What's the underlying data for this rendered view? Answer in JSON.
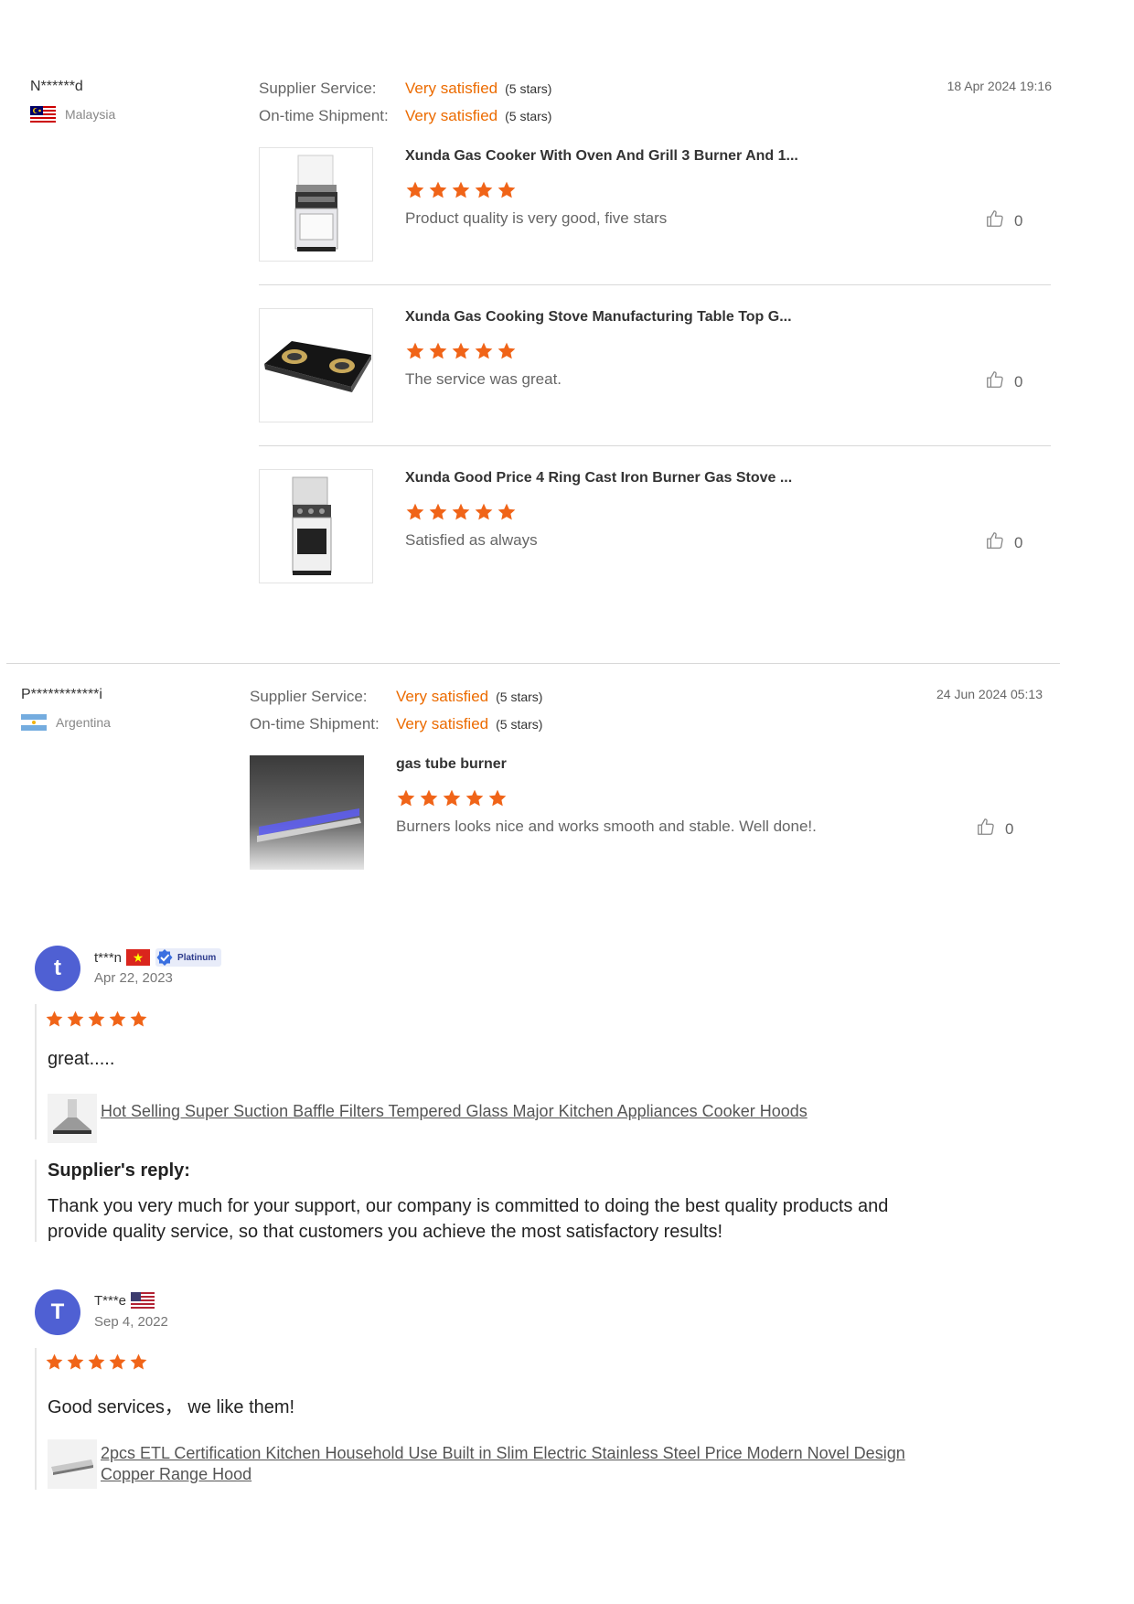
{
  "colors": {
    "accent": "#ec6b00",
    "star": "#f06418",
    "avatar": "#4f60d3"
  },
  "reviews": [
    {
      "user": "N******d",
      "country": "Malaysia",
      "flag": "malaysia-flag",
      "supplier_service_label": "Supplier Service:",
      "supplier_service_value": "Very satisfied",
      "supplier_service_stars": "(5 stars)",
      "shipment_label": "On-time Shipment:",
      "shipment_value": "Very satisfied",
      "shipment_stars": "(5 stars)",
      "date": "18 Apr 2024 19:16",
      "items": [
        {
          "title": "Xunda Gas Cooker With Oven And Grill 3 Burner And 1...",
          "rating": 5,
          "text": "Product quality is very good, five stars",
          "likes": "0"
        },
        {
          "title": "Xunda Gas Cooking Stove Manufacturing Table Top G...",
          "rating": 5,
          "text": "The service was great.",
          "likes": "0"
        },
        {
          "title": "Xunda Good Price 4 Ring Cast Iron Burner Gas Stove ...",
          "rating": 5,
          "text": "Satisfied as always",
          "likes": "0"
        }
      ]
    },
    {
      "user": "P************i",
      "country": "Argentina",
      "flag": "argentina-flag",
      "supplier_service_label": "Supplier Service:",
      "supplier_service_value": "Very satisfied",
      "supplier_service_stars": "(5 stars)",
      "shipment_label": "On-time Shipment:",
      "shipment_value": "Very satisfied",
      "shipment_stars": "(5 stars)",
      "date": "24 Jun 2024 05:13",
      "items": [
        {
          "title": "gas tube burner",
          "rating": 5,
          "text": "Burners looks nice and works smooth and stable. Well done!.",
          "likes": "0"
        }
      ]
    }
  ],
  "new_reviews": [
    {
      "avatar_letter": "t",
      "user": "t***n",
      "flag": "vietnam-flag",
      "badge": "Platinum",
      "date": "Apr 22, 2023",
      "rating": 5,
      "text": "great.....",
      "product_link": "Hot Selling Super Suction Baffle Filters Tempered Glass Major Kitchen Appliances Cooker Hoods",
      "reply_heading": "Supplier's reply:",
      "reply_text": "Thank you very much for your support, our company is committed to doing the best quality products and provide quality service, so that customers you achieve the most satisfactory results!"
    },
    {
      "avatar_letter": "T",
      "user": "T***e",
      "flag": "usa-flag",
      "date": "Sep 4, 2022",
      "rating": 5,
      "text": "Good services， we like them!",
      "product_link": "2pcs ETL Certification Kitchen Household Use Built in Slim Electric Stainless Steel Price Modern Novel Design Copper Range Hood"
    }
  ]
}
